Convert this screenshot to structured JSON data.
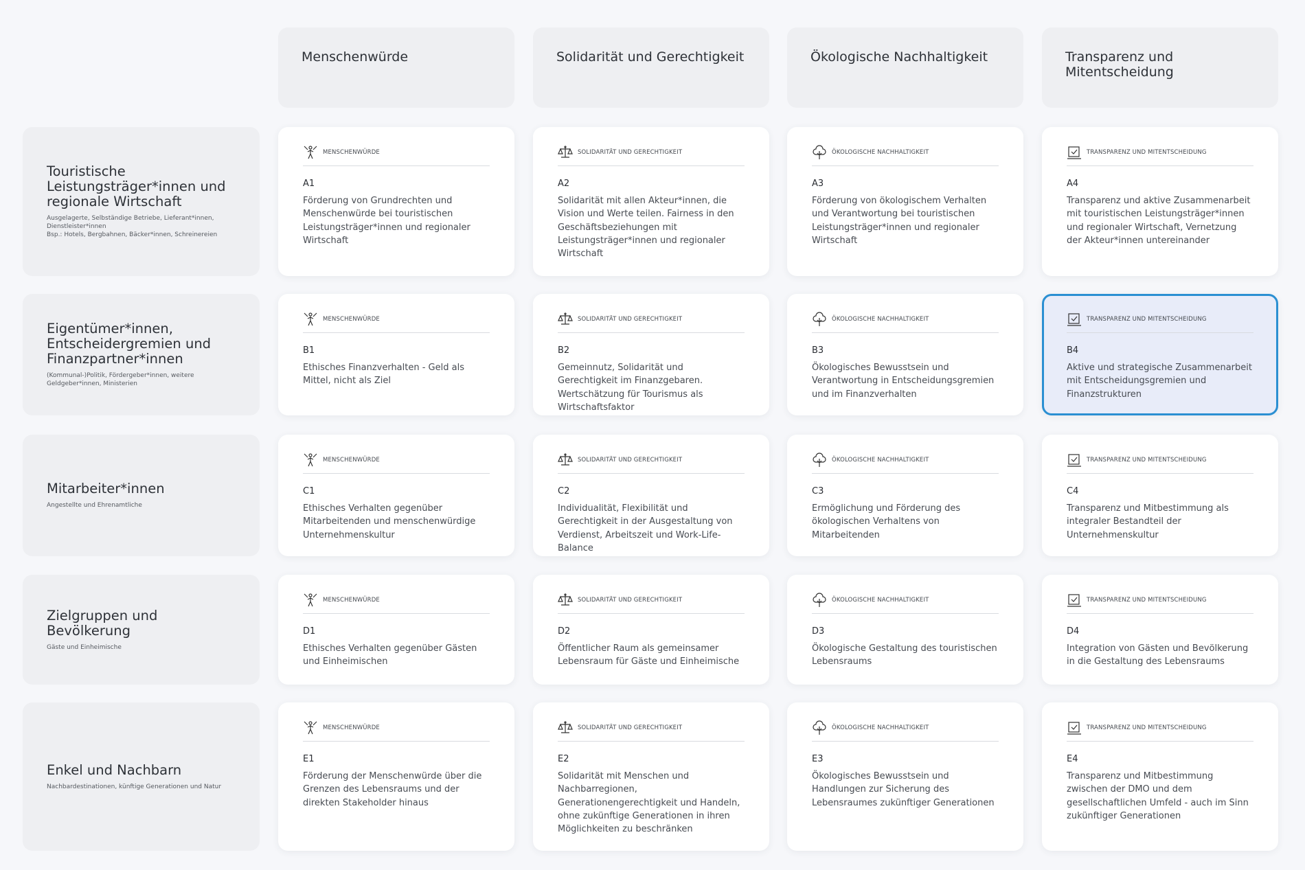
{
  "columns": [
    {
      "title": "Menschenwürde"
    },
    {
      "title": "Solidarität und Gerechtigkeit"
    },
    {
      "title": "Ökologische Nachhaltigkeit"
    },
    {
      "title": "Transparenz und Mitentscheidung"
    }
  ],
  "categories": {
    "c1": "Menschenwürde",
    "c2": "Solidarität und Gerechtigkeit",
    "c3": "Ökologische Nachhaltigkeit",
    "c4": "Transparenz und Mitentscheidung"
  },
  "icons": {
    "c1": "human-dignity-icon",
    "c2": "scales-icon",
    "c3": "tree-icon",
    "c4": "checkbox-icon"
  },
  "accent_color": "#2a8fd2",
  "rows": [
    {
      "title": "Touristische Leistungsträger*innen und regionale Wirtschaft",
      "subtitle": "Ausgelagerte, Selbständige Betriebe, Lieferant*innen, Dienstleister*innen\nBsp.: Hotels, Bergbahnen, Bäcker*innen, Schreinereien",
      "cells": [
        {
          "code": "A1",
          "text": "Förderung von Grundrechten und Menschenwürde bei touristischen Leistungsträger*innen und regionaler Wirtschaft"
        },
        {
          "code": "A2",
          "text": "Solidarität mit allen Akteur*innen, die Vision und Werte teilen. Fairness in den Geschäftsbeziehungen mit Leistungsträger*innen und regionaler Wirtschaft"
        },
        {
          "code": "A3",
          "text": "Förderung von ökologischem Verhalten und Verantwortung bei touristischen Leistungsträger*innen und regionaler Wirtschaft"
        },
        {
          "code": "A4",
          "text": "Transparenz und aktive Zusammenarbeit mit touristischen Leistungsträger*innen und regionaler Wirtschaft, Vernetzung der Akteur*innen untereinander"
        }
      ]
    },
    {
      "title": "Eigentümer*innen, Entscheidergremien und Finanzpartner*innen",
      "subtitle": "(Kommunal-)Politik, Fördergeber*innen, weitere Geldgeber*innen, Ministerien",
      "cells": [
        {
          "code": "B1",
          "text": "Ethisches Finanzverhalten - Geld als Mittel, nicht als Ziel"
        },
        {
          "code": "B2",
          "text": "Gemeinnutz, Solidarität und Gerechtigkeit im Finanzgebaren. Wertschätzung für Tourismus als Wirtschaftsfaktor"
        },
        {
          "code": "B3",
          "text": "Ökologisches Bewusstsein und Verantwortung in Entscheidungsgremien und im Finanzverhalten"
        },
        {
          "code": "B4",
          "text": "Aktive und strategische Zusammenarbeit mit Entscheidungsgremien und Finanzstrukturen"
        }
      ]
    },
    {
      "title": "Mitarbeiter*innen",
      "subtitle": "Angestellte und Ehrenamtliche",
      "cells": [
        {
          "code": "C1",
          "text": "Ethisches Verhalten gegenüber Mitarbeitenden und menschenwürdige Unternehmenskultur"
        },
        {
          "code": "C2",
          "text": "Individualität, Flexibilität und Gerechtigkeit in der Ausgestaltung von Verdienst, Arbeitszeit und Work-Life-Balance"
        },
        {
          "code": "C3",
          "text": "Ermöglichung und Förderung des ökologischen Verhaltens von Mitarbeitenden"
        },
        {
          "code": "C4",
          "text": "Transparenz und Mitbestimmung als integraler Bestandteil der Unternehmenskultur"
        }
      ]
    },
    {
      "title": "Zielgruppen und Bevölkerung",
      "subtitle": "Gäste und Einheimische",
      "cells": [
        {
          "code": "D1",
          "text": "Ethisches Verhalten gegenüber Gästen und Einheimischen"
        },
        {
          "code": "D2",
          "text": "Öffentlicher Raum als gemeinsamer Lebensraum für Gäste und Einheimische"
        },
        {
          "code": "D3",
          "text": "Ökologische Gestaltung des touristischen Lebensraums"
        },
        {
          "code": "D4",
          "text": "Integration von Gästen und Bevölkerung in die Gestaltung des Lebensraums"
        }
      ]
    },
    {
      "title": "Enkel und Nachbarn",
      "subtitle": "Nachbardestinationen, künftige Generationen und Natur",
      "cells": [
        {
          "code": "E1",
          "text": "Förderung der Menschenwürde über die Grenzen des Lebensraums und der direkten Stakeholder hinaus"
        },
        {
          "code": "E2",
          "text": "Solidarität mit Menschen und Nachbarregionen, Generationengerechtigkeit und Handeln, ohne zukünftige Generationen in ihren Möglichkeiten zu beschränken"
        },
        {
          "code": "E3",
          "text": "Ökologisches Bewusstsein und Handlungen zur Sicherung des Lebensraumes zukünftiger Generationen"
        },
        {
          "code": "E4",
          "text": "Transparenz und Mitbestimmung zwischen der DMO und dem gesellschaftlichen Umfeld - auch im Sinn zukünftiger Generationen"
        }
      ]
    }
  ]
}
